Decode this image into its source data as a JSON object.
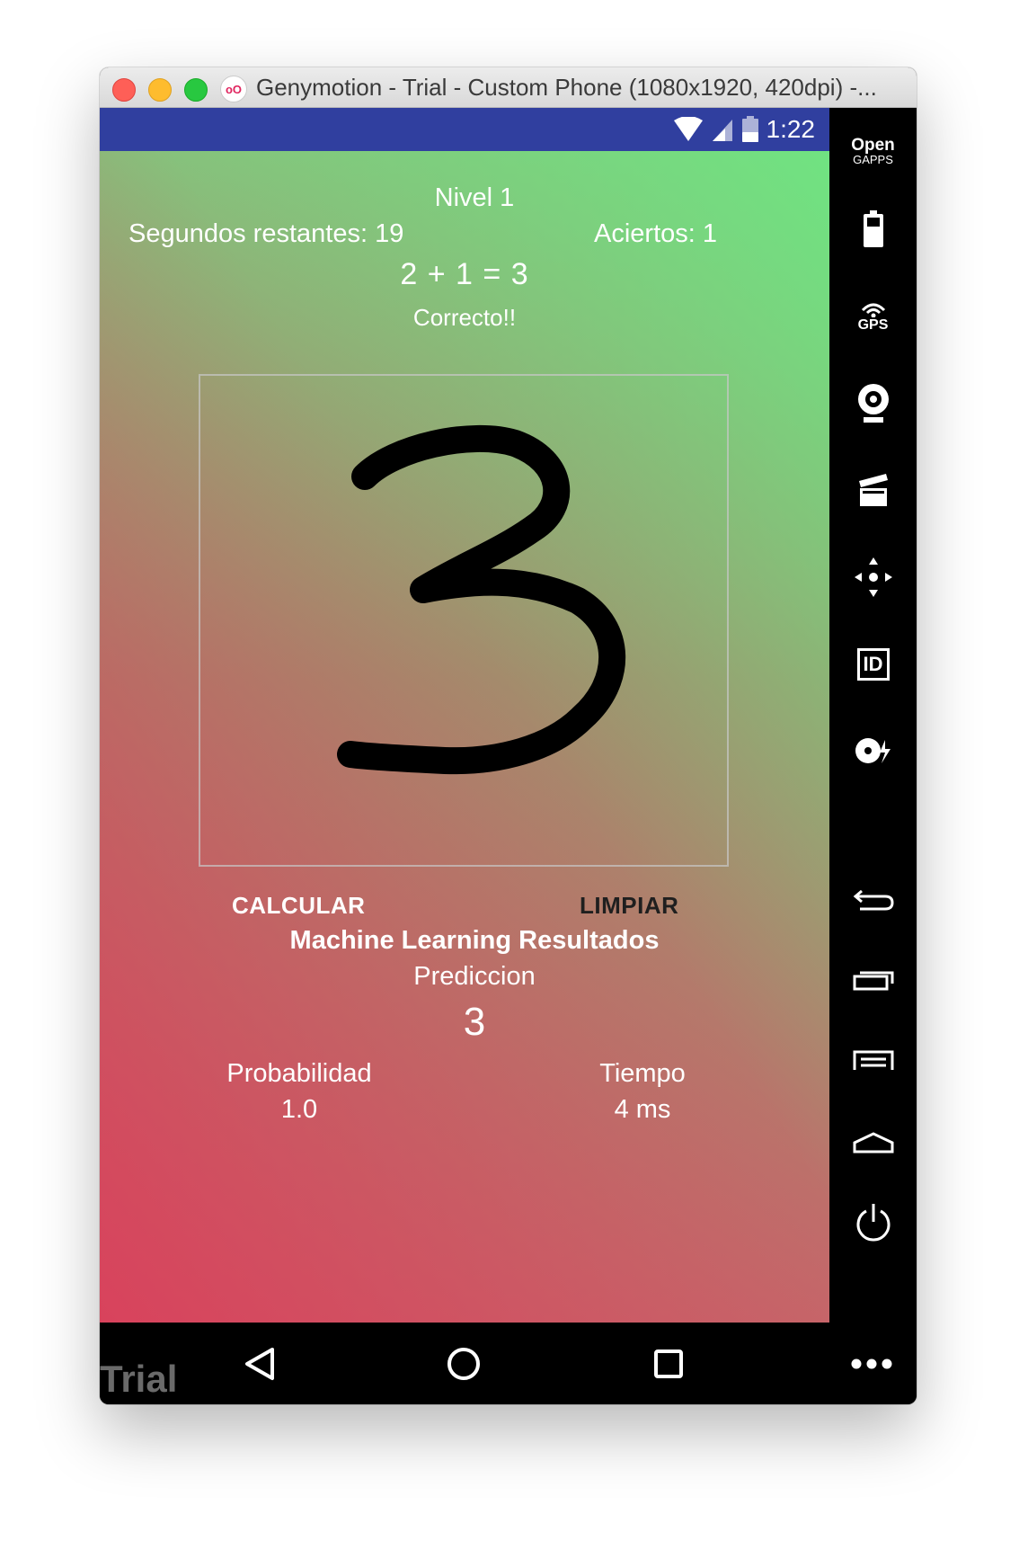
{
  "window": {
    "title": "Genymotion - Trial - Custom Phone (1080x1920, 420dpi) -...",
    "app_icon": "genymotion-icon"
  },
  "status_bar": {
    "time": "1:22",
    "icons": [
      "wifi-icon",
      "signal-icon",
      "battery-icon"
    ],
    "color": "#303f9f"
  },
  "game": {
    "level": "Nivel 1",
    "seconds_remaining": "Segundos restantes: 19",
    "hits": "Aciertos: 1",
    "equation": "2 + 1 = 3",
    "feedback": "Correcto!!",
    "drawn_digit": "3"
  },
  "buttons": {
    "calculate": "CALCULAR",
    "clear": "LIMPIAR"
  },
  "results": {
    "heading": "Machine Learning Resultados",
    "prediction_label": "Prediccion",
    "prediction_value": "3",
    "probability_label": "Probabilidad",
    "probability_value": "1.0",
    "time_label": "Tiempo",
    "time_value": "4 ms"
  },
  "sidebar": {
    "open_gapps_line1": "Open",
    "open_gapps_line2": "GAPPS",
    "gps_label": "GPS",
    "id_label": "ID",
    "items": [
      "open-gapps-icon",
      "battery-widget-icon",
      "gps-icon",
      "webcam-icon",
      "media-clapper-icon",
      "dpad-icon",
      "identifiers-icon",
      "disk-io-icon",
      "back-icon",
      "recent-apps-icon",
      "menu-icon",
      "home-icon",
      "power-icon",
      "more-icon"
    ]
  },
  "nav_bar": {
    "trial_watermark": "Trial",
    "icons": [
      "back-triangle-icon",
      "home-circle-icon",
      "recents-square-icon"
    ]
  },
  "colors": {
    "gradient_top": "#6fe28a",
    "gradient_bottom": "#dc4158",
    "text": "#ffffff",
    "clear_button_text": "#1f1f1f"
  }
}
